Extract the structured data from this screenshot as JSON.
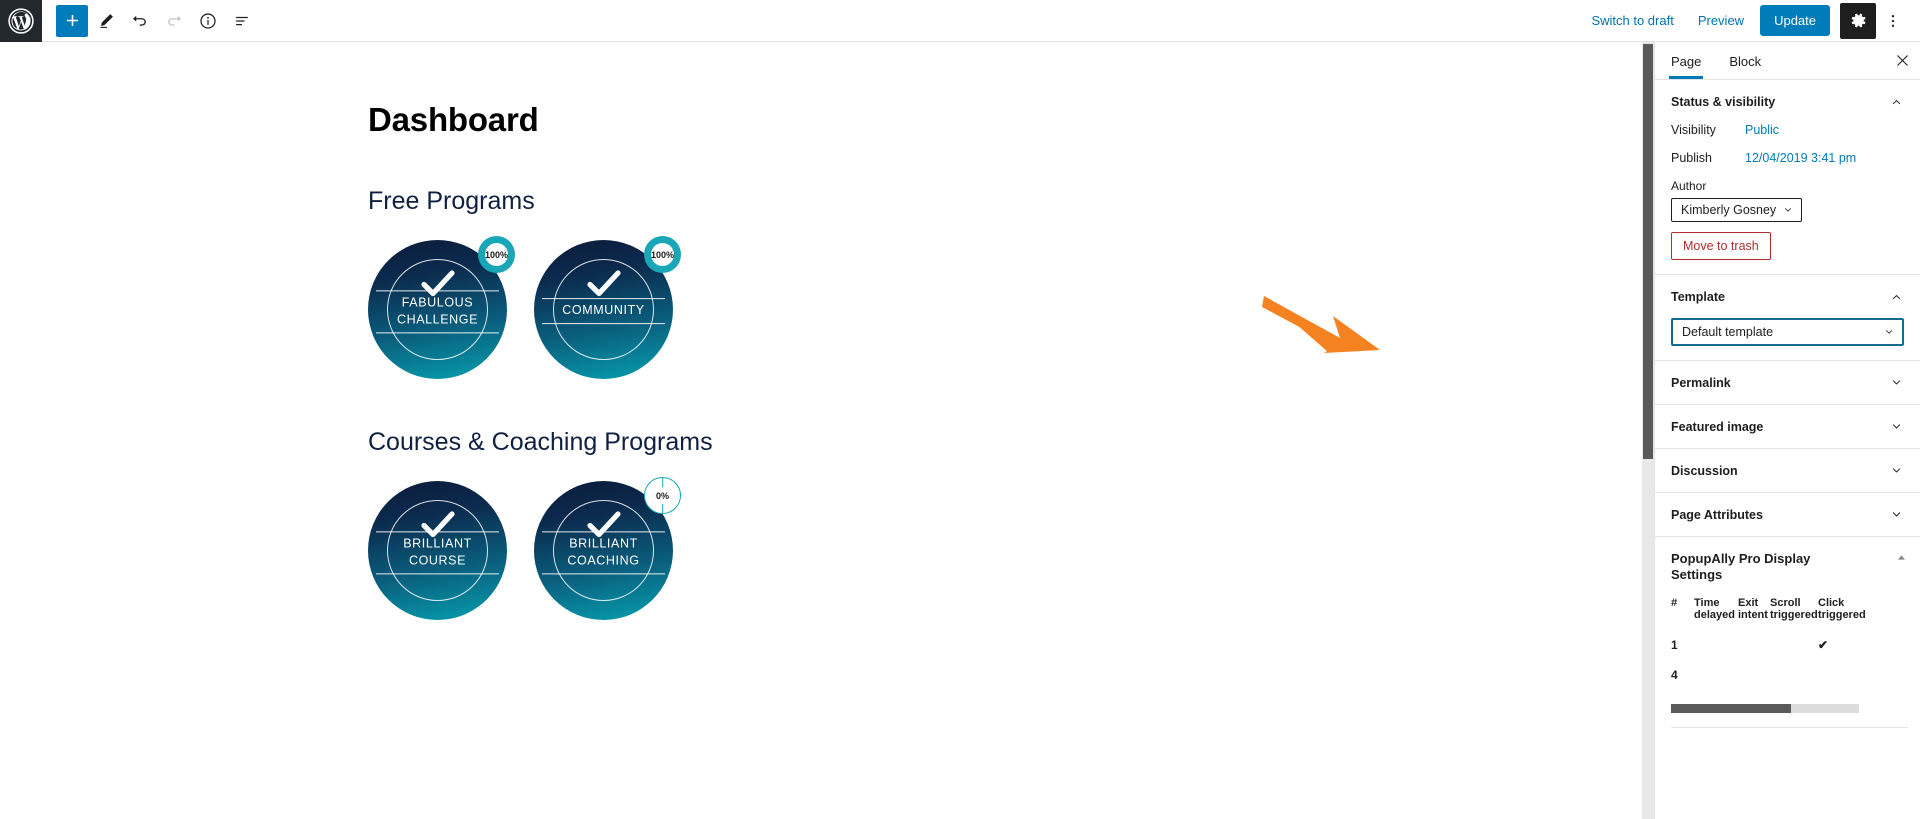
{
  "topbar": {
    "logo_icon": "wordpress-logo-icon",
    "add_block_icon": "plus-icon",
    "edit_icon": "pencil-icon",
    "undo_icon": "undo-arrow-icon",
    "redo_icon": "redo-arrow-icon",
    "info_icon": "info-circle-icon",
    "list_view_icon": "list-view-icon",
    "switch_to_draft": "Switch to draft",
    "preview": "Preview",
    "update": "Update",
    "settings_icon": "gear-icon",
    "more_icon": "three-dots-vertical-icon",
    "accent": "#007cba"
  },
  "canvas": {
    "title": "Dashboard",
    "sections": [
      {
        "heading": "Free Programs",
        "items": [
          {
            "label_line1": "FABULOUS",
            "label_line2": "CHALLENGE",
            "percent": "100%",
            "complete": true
          },
          {
            "label_line1": "COMMUNITY",
            "label_line2": "",
            "percent": "100%",
            "complete": true
          }
        ]
      },
      {
        "heading": "Courses & Coaching Programs",
        "items": [
          {
            "label_line1": "BRILLIANT",
            "label_line2": "COURSE",
            "percent": "",
            "complete": true
          },
          {
            "label_line1": "BRILLIANT",
            "label_line2": "COACHING",
            "percent": "0%",
            "complete": true
          }
        ]
      }
    ],
    "annotation_arrow_color": "#F58220",
    "circle_gradient_top": "#0c1b3a",
    "circle_gradient_bottom": "#06a0af",
    "badge_teal": "#19a7b8"
  },
  "sidebar": {
    "tabs": [
      {
        "label": "Page",
        "active": true
      },
      {
        "label": "Block",
        "active": false
      }
    ],
    "close_icon": "close-icon",
    "status": {
      "title": "Status & visibility",
      "expanded": true,
      "visibility_label": "Visibility",
      "visibility_value": "Public",
      "publish_label": "Publish",
      "publish_value": "12/04/2019 3:41 pm",
      "author_label": "Author",
      "author_value": "Kimberly Gosney",
      "trash_label": "Move to trash"
    },
    "template": {
      "title": "Template",
      "expanded": true,
      "value": "Default template"
    },
    "collapsed_panels": [
      {
        "title": "Permalink"
      },
      {
        "title": "Featured image"
      },
      {
        "title": "Discussion"
      },
      {
        "title": "Page Attributes"
      }
    ],
    "popupally": {
      "title": "PopupAlly Pro Display Settings",
      "columns": [
        "#",
        "Time delayed",
        "Exit intent",
        "Scroll triggered",
        "Click triggered"
      ],
      "rows": [
        {
          "num": "1",
          "time_delayed": "",
          "exit_intent": "",
          "scroll_triggered": "",
          "click_triggered": "✔"
        },
        {
          "num": "4",
          "time_delayed": "",
          "exit_intent": "",
          "scroll_triggered": "",
          "click_triggered": ""
        }
      ]
    }
  }
}
